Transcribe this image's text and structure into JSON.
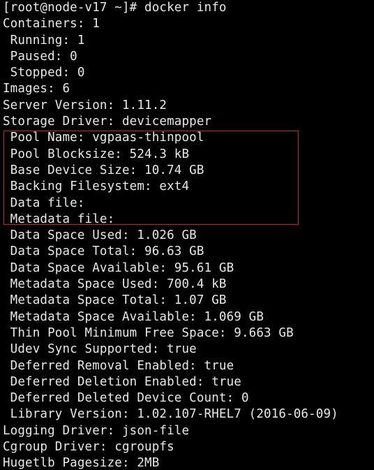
{
  "terminal": {
    "lines": [
      "[root@node-v17 ~]# docker info",
      "Containers: 1",
      " Running: 1",
      " Paused: 0",
      " Stopped: 0",
      "Images: 6",
      "Server Version: 1.11.2",
      "Storage Driver: devicemapper",
      " Pool Name: vgpaas-thinpool",
      " Pool Blocksize: 524.3 kB",
      " Base Device Size: 10.74 GB",
      " Backing Filesystem: ext4",
      " Data file:",
      " Metadata file:",
      " Data Space Used: 1.026 GB",
      " Data Space Total: 96.63 GB",
      " Data Space Available: 95.61 GB",
      " Metadata Space Used: 700.4 kB",
      " Metadata Space Total: 1.07 GB",
      " Metadata Space Available: 1.069 GB",
      " Thin Pool Minimum Free Space: 9.663 GB",
      " Udev Sync Supported: true",
      " Deferred Removal Enabled: true",
      " Deferred Deletion Enabled: true",
      " Deferred Deleted Device Count: 0",
      " Library Version: 1.02.107-RHEL7 (2016-06-09)",
      "Logging Driver: json-file",
      "Cgroup Driver: cgroupfs",
      "Hugetlb Pagesize: 2MB"
    ],
    "colors": {
      "background": "#000000",
      "text": "#e8e8e8",
      "highlight_border": "#d41a1a"
    }
  }
}
